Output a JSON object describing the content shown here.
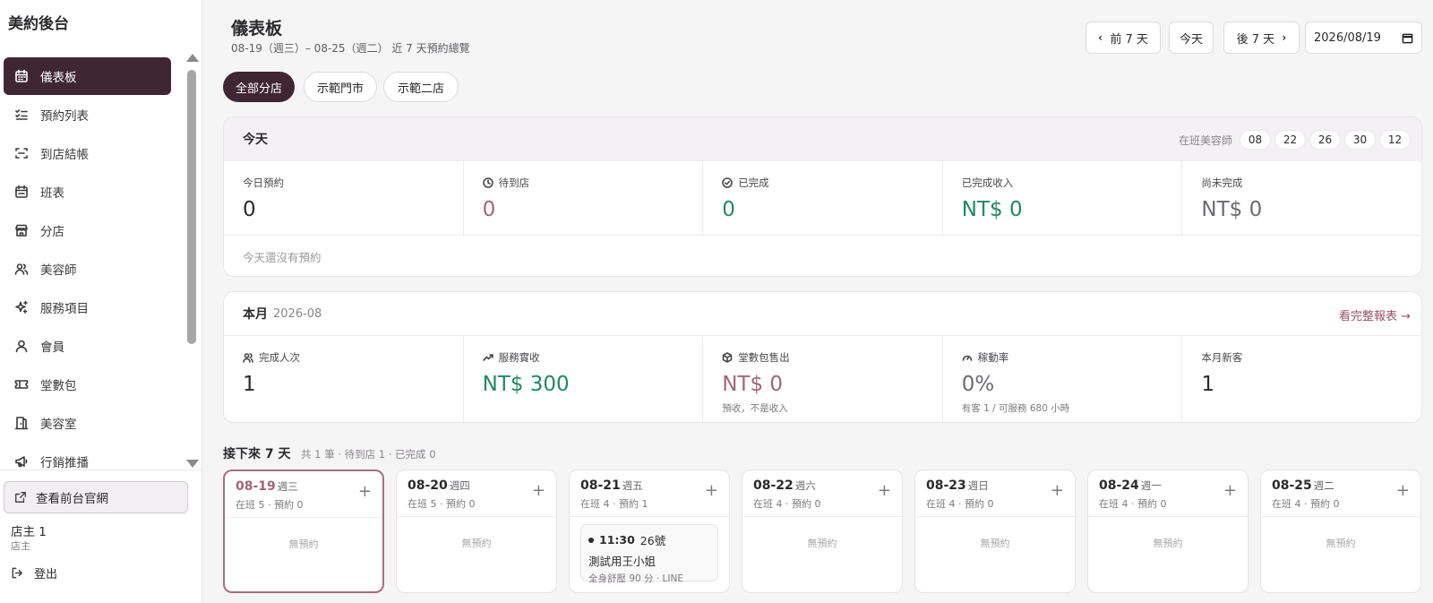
{
  "sidebar": {
    "brand": "美約後台",
    "items": [
      {
        "label": "儀表板",
        "icon": "calendar-icon"
      },
      {
        "label": "預約列表",
        "icon": "list-check-icon"
      },
      {
        "label": "到店結帳",
        "icon": "scan-icon"
      },
      {
        "label": "班表",
        "icon": "schedule-icon"
      },
      {
        "label": "分店",
        "icon": "store-icon"
      },
      {
        "label": "美容師",
        "icon": "users-icon"
      },
      {
        "label": "服務項目",
        "icon": "sparkle-icon"
      },
      {
        "label": "會員",
        "icon": "user-icon"
      },
      {
        "label": "堂數包",
        "icon": "ticket-icon"
      },
      {
        "label": "美容室",
        "icon": "door-icon"
      },
      {
        "label": "行銷推播",
        "icon": "megaphone-icon"
      }
    ],
    "front_link": "查看前台官網",
    "user_name": "店主 1",
    "user_role": "店主",
    "logout": "登出"
  },
  "header": {
    "title": "儀表板",
    "subtitle": "08-19（週三）– 08-25（週二） 近 7 天預約總覽",
    "prev_label": "前 7 天",
    "today_label": "今天",
    "next_label": "後 7 天",
    "date_value": "2026/08/19"
  },
  "branch_tabs": [
    "全部分店",
    "示範門市",
    "示範二店"
  ],
  "today": {
    "title": "今天",
    "staff_label": "在班美容師",
    "staff_chips": [
      "08",
      "22",
      "26",
      "30",
      "12"
    ],
    "stats": [
      {
        "label": "今日預約",
        "value": "0"
      },
      {
        "label": "待到店",
        "value": "0"
      },
      {
        "label": "已完成",
        "value": "0"
      },
      {
        "label": "已完成收入",
        "value": "NT$ 0"
      },
      {
        "label": "尚未完成",
        "value": "NT$ 0"
      }
    ],
    "empty": "今天還沒有預約"
  },
  "month": {
    "title": "本月",
    "period": "2026-08",
    "report_link": "看完整報表 →",
    "stats": [
      {
        "label": "完成人次",
        "value": "1",
        "note": ""
      },
      {
        "label": "服務實收",
        "value": "NT$ 300",
        "note": ""
      },
      {
        "label": "堂數包售出",
        "value": "NT$ 0",
        "note": "預收，不是收入"
      },
      {
        "label": "稼動率",
        "value": "0%",
        "note": "有客 1 / 可服務 680 小時"
      },
      {
        "label": "本月新客",
        "value": "1",
        "note": ""
      }
    ]
  },
  "week": {
    "title": "接下來 7 天",
    "summary": "共 1 筆 · 待到店 1 · 已完成 0",
    "empty_label": "無預約",
    "days": [
      {
        "date": "08-19",
        "weekday": "週三",
        "meta": "在班 5 · 預約 0"
      },
      {
        "date": "08-20",
        "weekday": "週四",
        "meta": "在班 5 · 預約 0"
      },
      {
        "date": "08-21",
        "weekday": "週五",
        "meta": "在班 4 · 預約 1"
      },
      {
        "date": "08-22",
        "weekday": "週六",
        "meta": "在班 4 · 預約 0"
      },
      {
        "date": "08-23",
        "weekday": "週日",
        "meta": "在班 4 · 預約 0"
      },
      {
        "date": "08-24",
        "weekday": "週一",
        "meta": "在班 4 · 預約 0"
      },
      {
        "date": "08-25",
        "weekday": "週二",
        "meta": "在班 4 · 預約 0"
      }
    ],
    "booking": {
      "time": "11:30",
      "number": "26號",
      "name": "測試用王小姐",
      "service": "全身舒壓 90 分 · LINE"
    }
  },
  "colors": {
    "accent": "#3f2633",
    "rose": "#a3647a",
    "green": "#1f8a64"
  }
}
